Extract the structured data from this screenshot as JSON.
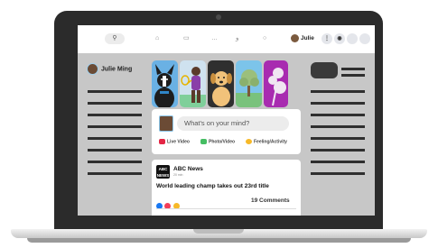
{
  "topbar": {
    "search_icon": "search-icon",
    "home_icon": "home-icon",
    "watch_icon": "watch-icon",
    "marketplace_icon": "marketplace-icon",
    "groups_icon": "groups-icon",
    "gaming_icon": "gaming-icon",
    "user_name": "Julie"
  },
  "left_sidebar": {
    "profile_name": "Julie Ming"
  },
  "composer": {
    "placeholder": "What's on your mind?",
    "actions": [
      {
        "label": "Live Video",
        "color": "#e42645"
      },
      {
        "label": "Photo/Video",
        "color": "#45bd62"
      },
      {
        "label": "Feeling/Activity",
        "color": "#f7b928"
      }
    ]
  },
  "post": {
    "logo_text": "ABC NEWS",
    "source": "ABC News",
    "time": "20 min",
    "headline": "World leading champ takes out 23rd title",
    "comments": "19 Comments",
    "reaction_colors": [
      "#1877f2",
      "#f33e58",
      "#f7b928"
    ]
  }
}
